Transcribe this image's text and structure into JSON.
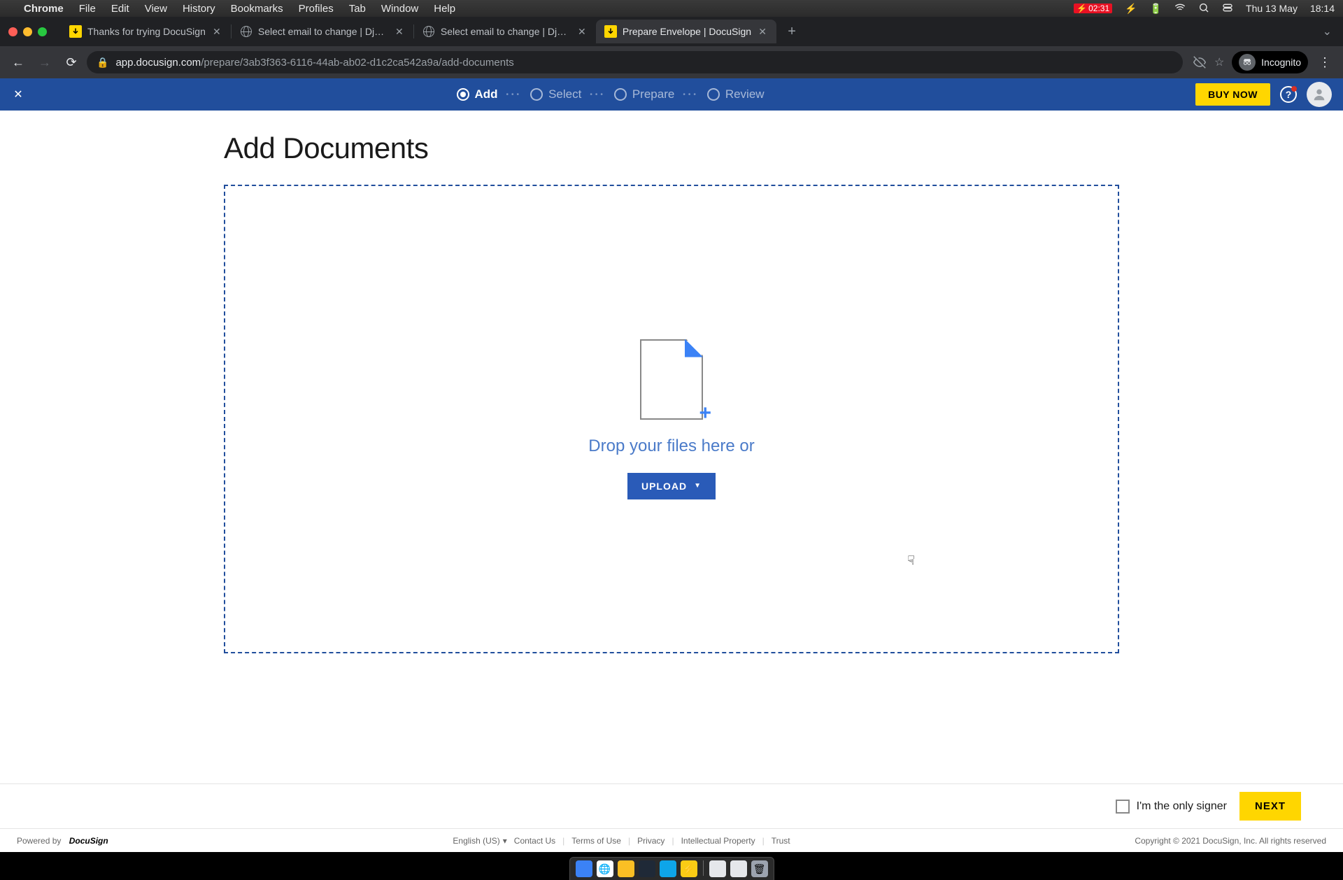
{
  "macMenu": {
    "appName": "Chrome",
    "items": [
      "File",
      "Edit",
      "View",
      "History",
      "Bookmarks",
      "Profiles",
      "Tab",
      "Window",
      "Help"
    ],
    "batteryTime": "02:31",
    "date": "Thu 13 May",
    "time": "18:14"
  },
  "tabs": [
    {
      "title": "Thanks for trying DocuSign",
      "active": false,
      "favicon": "ds"
    },
    {
      "title": "Select email to change | Djang",
      "active": false,
      "favicon": "globe"
    },
    {
      "title": "Select email to change | Djang",
      "active": false,
      "favicon": "globe"
    },
    {
      "title": "Prepare Envelope | DocuSign",
      "active": true,
      "favicon": "ds"
    }
  ],
  "url": {
    "host": "app.docusign.com",
    "path": "/prepare/3ab3f363-6116-44ab-ab02-d1c2ca542a9a/add-documents",
    "incognito": "Incognito"
  },
  "dsHeader": {
    "steps": [
      {
        "label": "Add",
        "active": true
      },
      {
        "label": "Select",
        "active": false
      },
      {
        "label": "Prepare",
        "active": false
      },
      {
        "label": "Review",
        "active": false
      }
    ],
    "buyNow": "BUY NOW"
  },
  "page": {
    "title": "Add Documents",
    "dropText": "Drop your files here or",
    "uploadLabel": "UPLOAD"
  },
  "actionBar": {
    "onlySigner": "I'm the only signer",
    "next": "NEXT"
  },
  "footer": {
    "poweredBy": "Powered by",
    "brand": "DocuSign",
    "lang": "English (US)",
    "links": [
      "Contact Us",
      "Terms of Use",
      "Privacy",
      "Intellectual Property",
      "Trust"
    ],
    "copyright": "Copyright © 2021 DocuSign, Inc. All rights reserved"
  }
}
